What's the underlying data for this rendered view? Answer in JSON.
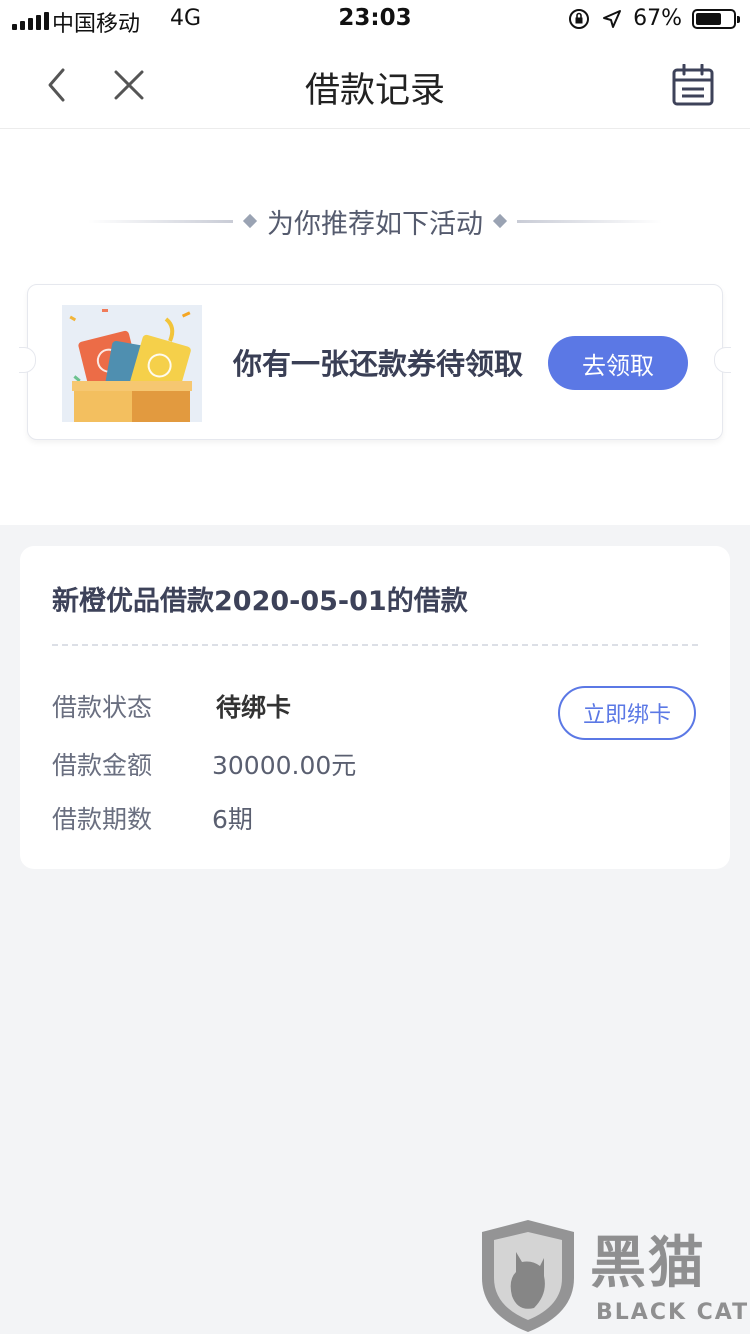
{
  "status_bar": {
    "carrier": "中国移动",
    "network": "4G",
    "time": "23:03",
    "battery": "67%",
    "battery_level": 0.67
  },
  "nav": {
    "title": "借款记录",
    "back_icon": "chevron-left-icon",
    "close_icon": "close-icon",
    "calendar_icon": "calendar-icon"
  },
  "recommend": {
    "title": "为你推荐如下活动",
    "coupon_text": "你有一张还款券待领取",
    "claim_label": "去领取"
  },
  "loan": {
    "title": "新橙优品借款2020-05-01的借款",
    "rows": [
      {
        "label": "借款状态",
        "value": "待绑卡"
      },
      {
        "label": "借款金额",
        "value": "30000.00元"
      },
      {
        "label": "借款期数",
        "value": "6期"
      }
    ],
    "bind_label": "立即绑卡"
  },
  "watermark": {
    "text": "黑猫",
    "sub": "BLACK CAT"
  },
  "colors": {
    "accent": "#5b78e5",
    "background": "#f3f4f6"
  }
}
